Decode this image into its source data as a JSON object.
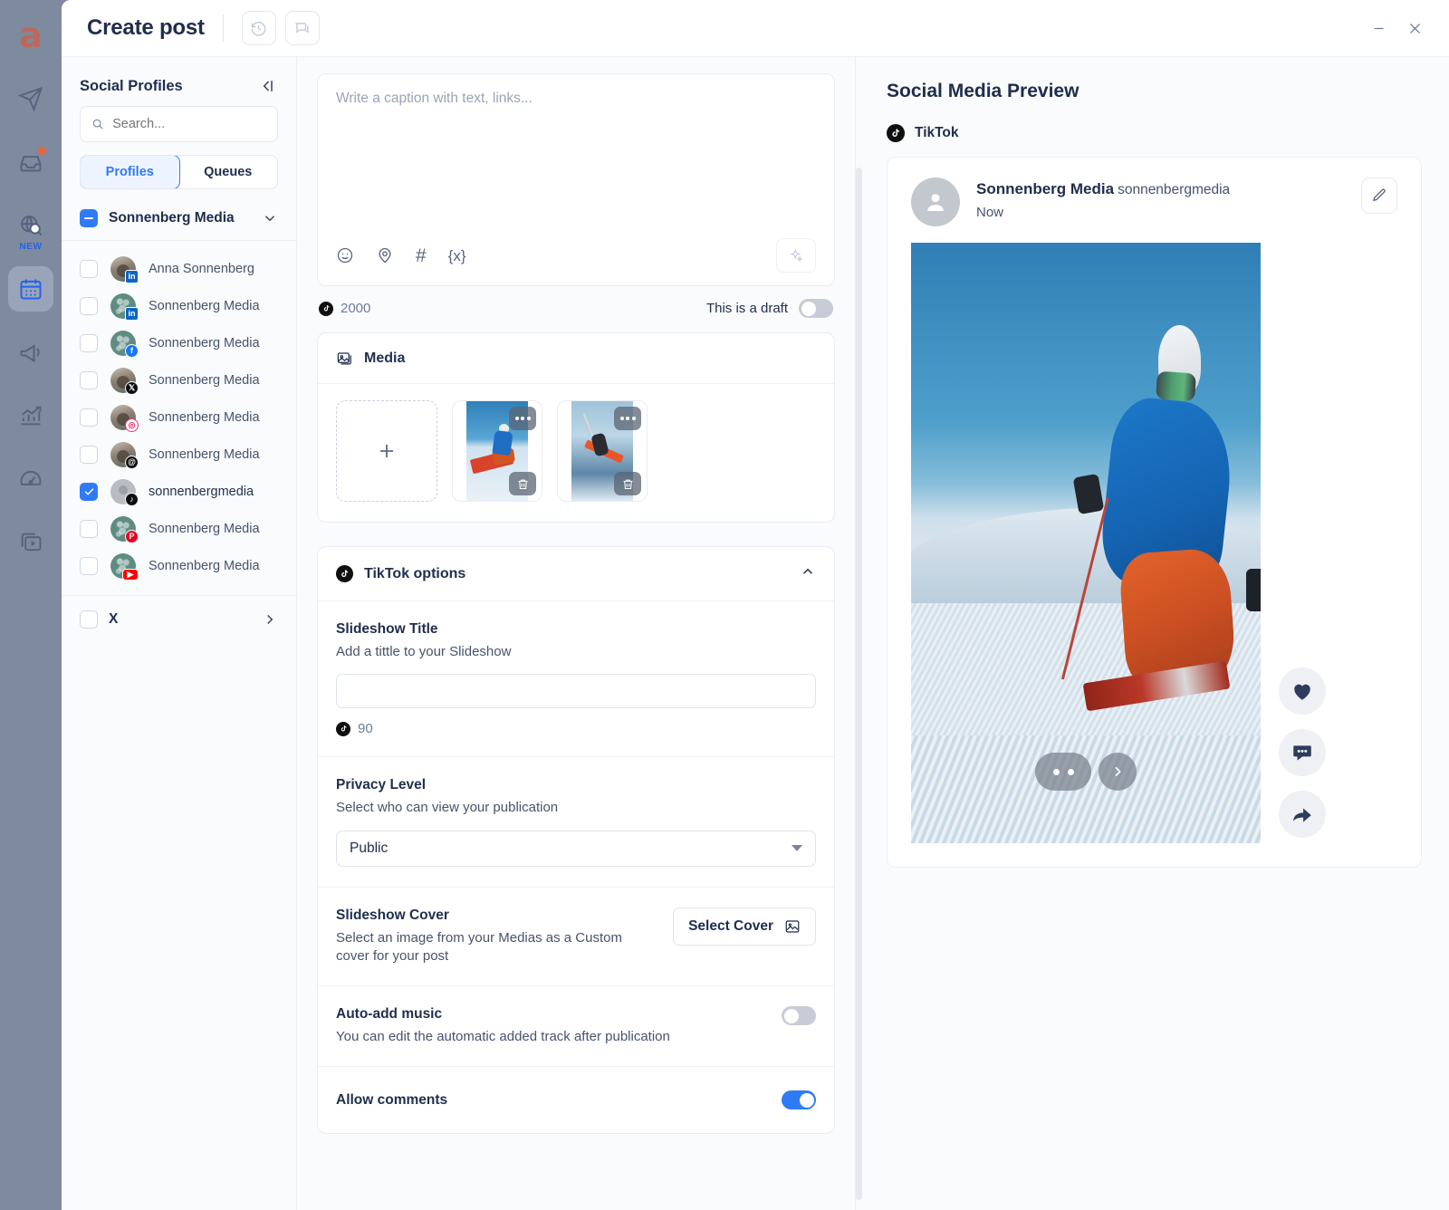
{
  "app_rail": {
    "logo": "a",
    "items": [
      {
        "name": "publish-icon",
        "label": "Publish"
      },
      {
        "name": "inbox-icon",
        "label": "Inbox",
        "badge": true
      },
      {
        "name": "listening-icon",
        "label": "Listening",
        "tag": "NEW"
      },
      {
        "name": "calendar-icon",
        "label": "Calendar",
        "active": true
      },
      {
        "name": "campaign-icon",
        "label": "Campaigns"
      },
      {
        "name": "analytics-icon",
        "label": "Analytics"
      },
      {
        "name": "dashboard-icon",
        "label": "Dashboard"
      },
      {
        "name": "media-library-icon",
        "label": "Media Library"
      }
    ]
  },
  "titlebar": {
    "title": "Create post",
    "history_button": "history-icon",
    "comments_button": "comment-icon",
    "minimize": "minimize-icon",
    "close": "close-icon"
  },
  "sidebar": {
    "heading": "Social Profiles",
    "collapse_icon": "collapse-panel-icon",
    "search": {
      "value": "",
      "placeholder": "Search..."
    },
    "tabs": [
      {
        "label": "Profiles",
        "active": true
      },
      {
        "label": "Queues",
        "active": false
      }
    ],
    "group": {
      "name": "Sonnenberg Media",
      "checkbox_state": "indeterminate",
      "expanded": true
    },
    "profiles": [
      {
        "name": "Anna Sonnenberg",
        "network": "linkedin",
        "avatar": "person",
        "checked": false
      },
      {
        "name": "Sonnenberg Media",
        "network": "linkedin",
        "avatar": "logo",
        "checked": false
      },
      {
        "name": "Sonnenberg Media",
        "network": "facebook",
        "avatar": "logo",
        "checked": false
      },
      {
        "name": "Sonnenberg Media",
        "network": "x",
        "avatar": "person",
        "checked": false
      },
      {
        "name": "Sonnenberg Media",
        "network": "instagram",
        "avatar": "person",
        "checked": false
      },
      {
        "name": "Sonnenberg Media",
        "network": "threads",
        "avatar": "person",
        "checked": false
      },
      {
        "name": "sonnenbergmedia",
        "network": "tiktok",
        "avatar": "gray",
        "checked": true
      },
      {
        "name": "Sonnenberg Media",
        "network": "pinterest",
        "avatar": "logo",
        "checked": false
      },
      {
        "name": "Sonnenberg Media",
        "network": "youtube",
        "avatar": "logo",
        "checked": false
      }
    ],
    "second_group": {
      "name": "X",
      "checkbox_state": "unchecked",
      "expanded": false
    }
  },
  "editor": {
    "caption": {
      "value": "",
      "placeholder": "Write a caption with text, links..."
    },
    "tools": [
      {
        "name": "emoji-icon"
      },
      {
        "name": "location-icon"
      },
      {
        "name": "hashtag-icon"
      },
      {
        "name": "variable-icon"
      }
    ],
    "ai_button": "ai-sparkle-icon",
    "char_count": "2000",
    "draft_label": "This is a draft",
    "draft_toggle_on": false,
    "media": {
      "section_title": "Media",
      "add_label": "+",
      "items": [
        {
          "alt": "Skier carving a turn on a groomed slope"
        },
        {
          "alt": "Freestyle skier mid-air jump over mountains"
        }
      ],
      "item_menu_icon": "more-options-icon",
      "item_delete_icon": "trash-icon"
    },
    "tiktok_options": {
      "section_title": "TikTok options",
      "collapse_icon": "chevron-up-icon",
      "slideshow_title": {
        "label": "Slideshow Title",
        "description": "Add a tittle to your Slideshow",
        "value": "",
        "char_count": "90"
      },
      "privacy_level": {
        "label": "Privacy Level",
        "description": "Select who can view your publication",
        "selected": "Public"
      },
      "slideshow_cover": {
        "label": "Slideshow Cover",
        "description": "Select an image from your Medias as a Custom cover for your post",
        "button_label": "Select Cover",
        "button_icon": "image-icon"
      },
      "auto_add_music": {
        "label": "Auto-add music",
        "description": "You can edit the automatic added track after publication",
        "enabled": false
      },
      "allow_comments": {
        "label": "Allow comments",
        "enabled": true
      }
    }
  },
  "preview": {
    "title": "Social Media Preview",
    "network": {
      "name": "TikTok",
      "icon": "tiktok-icon"
    },
    "post": {
      "display_name": "Sonnenberg Media",
      "handle": "sonnenbergmedia",
      "timestamp": "Now",
      "edit_icon": "pencil-icon",
      "media_alt": "Skier carving a turn on a groomed slope",
      "carousel_next_icon": "chevron-right-icon",
      "actions": [
        {
          "name": "like-icon"
        },
        {
          "name": "comment-icon"
        },
        {
          "name": "share-icon"
        }
      ]
    }
  },
  "colors": {
    "accent_blue": "#2f7bf6",
    "text_dark": "#1f2d4d",
    "text_muted": "#46536d",
    "panel_bg": "#fafbfc",
    "rail_bg": "#7e8a9e",
    "logo_red": "#b96a5c",
    "badge_orange": "#e8643c"
  }
}
